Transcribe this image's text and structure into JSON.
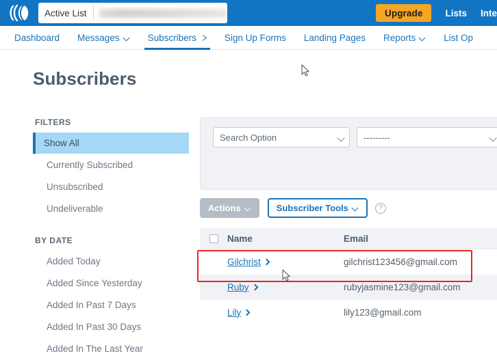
{
  "topbar": {
    "logo_icon": "aweber-arcs-logo",
    "active_list": {
      "label": "Active List",
      "value": "",
      "value_state": "blurred-redacted"
    },
    "upgrade_label": "Upgrade",
    "links": [
      {
        "label": "Lists"
      },
      {
        "label": "Inte"
      }
    ],
    "accent_blue": "#1175c4",
    "upgrade_color": "#f5a623"
  },
  "subnav": {
    "items": [
      {
        "label": "Dashboard",
        "caret": false,
        "active": false
      },
      {
        "label": "Messages",
        "caret": true,
        "active": false
      },
      {
        "label": "Subscribers",
        "caret": true,
        "active": true
      },
      {
        "label": "Sign Up Forms",
        "caret": false,
        "active": false
      },
      {
        "label": "Landing Pages",
        "caret": false,
        "active": false
      },
      {
        "label": "Reports",
        "caret": true,
        "active": false
      },
      {
        "label": "List Op",
        "caret": false,
        "active": false
      }
    ],
    "active_color": "#1a73b7"
  },
  "page": {
    "title": "Subscribers"
  },
  "sidebar": {
    "filters_heading": "FILTERS",
    "filters": [
      {
        "label": "Show All",
        "selected": true
      },
      {
        "label": "Currently Subscribed",
        "selected": false
      },
      {
        "label": "Unsubscribed",
        "selected": false
      },
      {
        "label": "Undeliverable",
        "selected": false
      }
    ],
    "bydate_heading": "BY DATE",
    "by_date": [
      {
        "label": "Added Today"
      },
      {
        "label": "Added Since Yesterday"
      },
      {
        "label": "Added In Past 7 Days"
      },
      {
        "label": "Added In Past 30 Days"
      },
      {
        "label": "Added In The Last Year"
      }
    ],
    "selected_bg": "#a5d8f6"
  },
  "filter_panel": {
    "search_option": {
      "value": "Search Option",
      "icon": "chevron-down-icon"
    },
    "secondary_select": {
      "value": "---------",
      "icon": "chevron-down-icon"
    }
  },
  "action_row": {
    "actions_label": "Actions",
    "subscriber_tools_label": "Subscriber Tools",
    "help_glyph": "?"
  },
  "table": {
    "columns": {
      "select_all": "",
      "name": "Name",
      "email": "Email"
    },
    "rows": [
      {
        "name": "Gilchrist",
        "email": "gilchrist123456@gmail.com",
        "alt": false
      },
      {
        "name": "Ruby",
        "email": "rubyjasmine123@gmail.com",
        "alt": true
      },
      {
        "name": "Lily",
        "email": "lily123@gmail.com",
        "alt": false
      }
    ]
  },
  "annotation": {
    "color": "#ee2222",
    "target_row": "Gilchrist"
  }
}
